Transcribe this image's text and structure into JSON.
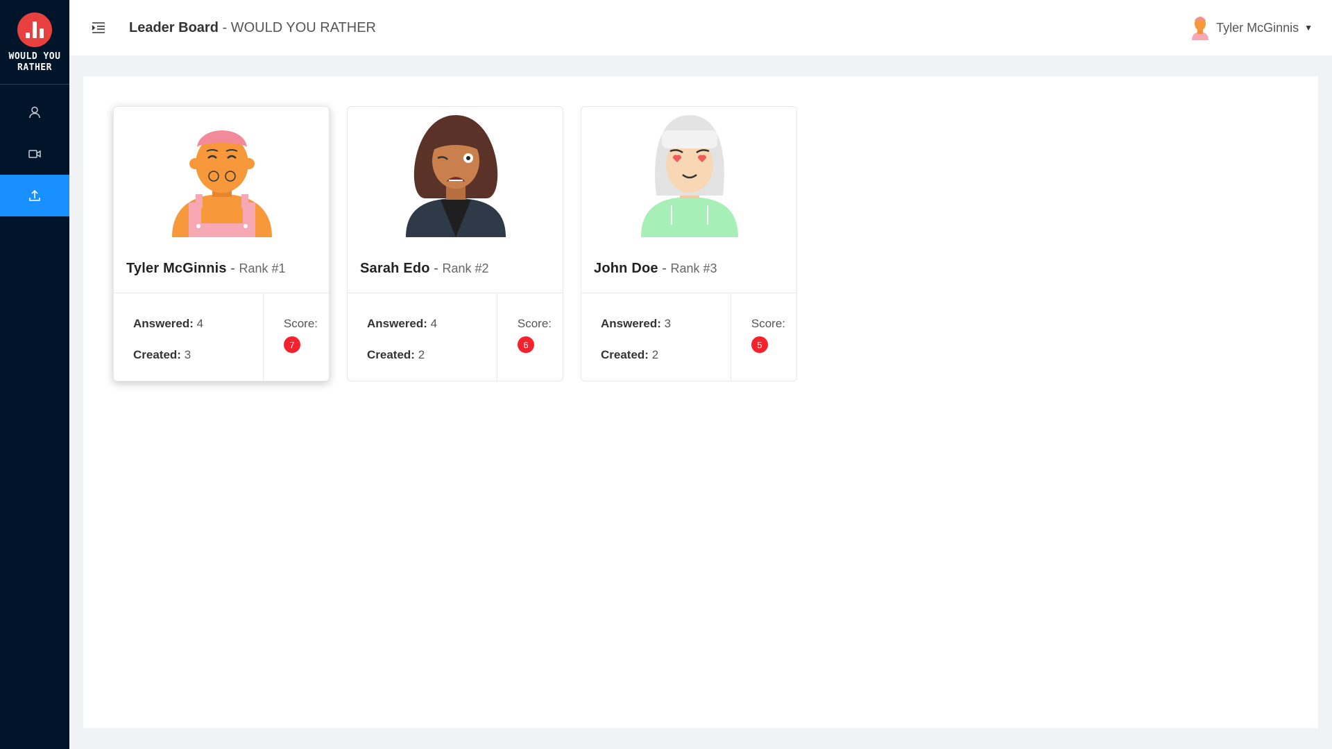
{
  "app": {
    "logo_text_line1": "WOULD YOU",
    "logo_text_line2": "RATHER",
    "brand_color": "#e8403f"
  },
  "sidebar": {
    "items": [
      {
        "icon": "user-icon",
        "active": false
      },
      {
        "icon": "video-camera-icon",
        "active": false
      },
      {
        "icon": "upload-icon",
        "active": true
      }
    ],
    "active_color": "#1890ff",
    "bg_color": "#001529"
  },
  "header": {
    "page_title": "Leader Board",
    "separator": " - ",
    "app_title": "WOULD YOU RATHER",
    "user_name": "Tyler McGinnis"
  },
  "leaderboard": {
    "answered_label": "Answered:",
    "created_label": "Created:",
    "score_label": "Score:",
    "cards": [
      {
        "name": "Tyler McGinnis",
        "rank": "Rank #1",
        "answered": "4",
        "created": "3",
        "score": "7"
      },
      {
        "name": "Sarah Edo",
        "rank": "Rank #2",
        "answered": "4",
        "created": "2",
        "score": "6"
      },
      {
        "name": "John Doe",
        "rank": "Rank #3",
        "answered": "3",
        "created": "2",
        "score": "5"
      }
    ]
  }
}
